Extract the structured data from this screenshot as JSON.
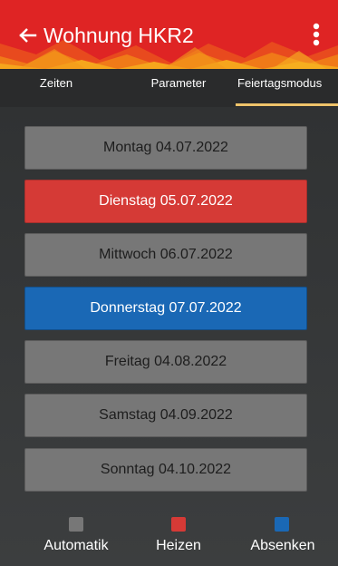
{
  "appbar": {
    "title": "Wohnung HKR2",
    "back_icon": "arrow-left-icon",
    "menu_icon": "more-vertical-icon",
    "color": "#df2424"
  },
  "tabs": [
    {
      "label": "Zeiten",
      "active": false
    },
    {
      "label": "Parameter",
      "active": false
    },
    {
      "label": "Feiertagsmodus",
      "active": true
    }
  ],
  "tab_indicator_color": "#efc36a",
  "days": [
    {
      "label": "Montag 04.07.2022",
      "mode": "Automatik"
    },
    {
      "label": "Dienstag 05.07.2022",
      "mode": "Heizen"
    },
    {
      "label": "Mittwoch 06.07.2022",
      "mode": "Automatik"
    },
    {
      "label": "Donnerstag 07.07.2022",
      "mode": "Absenken"
    },
    {
      "label": "Freitag 04.08.2022",
      "mode": "Automatik"
    },
    {
      "label": "Samstag 04.09.2022",
      "mode": "Automatik"
    },
    {
      "label": "Sonntag 04.10.2022",
      "mode": "Automatik"
    }
  ],
  "legend": [
    {
      "label": "Automatik",
      "color": "#777777"
    },
    {
      "label": "Heizen",
      "color": "#d53a36"
    },
    {
      "label": "Absenken",
      "color": "#1a68b5"
    }
  ]
}
